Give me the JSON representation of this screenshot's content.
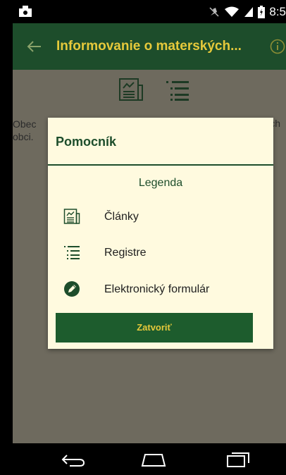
{
  "status_bar": {
    "time": "8:5",
    "icons": [
      "notification-icon",
      "mute-icon",
      "wifi-icon",
      "signal-icon",
      "battery-icon"
    ]
  },
  "app_bar": {
    "title": "Informovanie o materských...",
    "back_icon": "arrow-left-icon",
    "info_icon": "info-icon"
  },
  "content": {
    "text_left_line1": "Obec",
    "text_left_line2": "obci.",
    "text_right": "ách"
  },
  "dialog": {
    "title": "Pomocník",
    "legend_heading": "Legenda",
    "items": [
      {
        "icon": "article-icon",
        "label": "Články"
      },
      {
        "icon": "list-icon",
        "label": "Registre"
      },
      {
        "icon": "pencil-circle-icon",
        "label": "Elektronický formulár"
      }
    ],
    "close_label": "Zatvoriť"
  },
  "nav_bar": {
    "icons": [
      "back-nav-icon",
      "home-nav-icon",
      "recents-nav-icon"
    ]
  },
  "colors": {
    "primary": "#1d4d2b",
    "accent": "#e6c93b",
    "dialog_bg": "#fffadf"
  }
}
